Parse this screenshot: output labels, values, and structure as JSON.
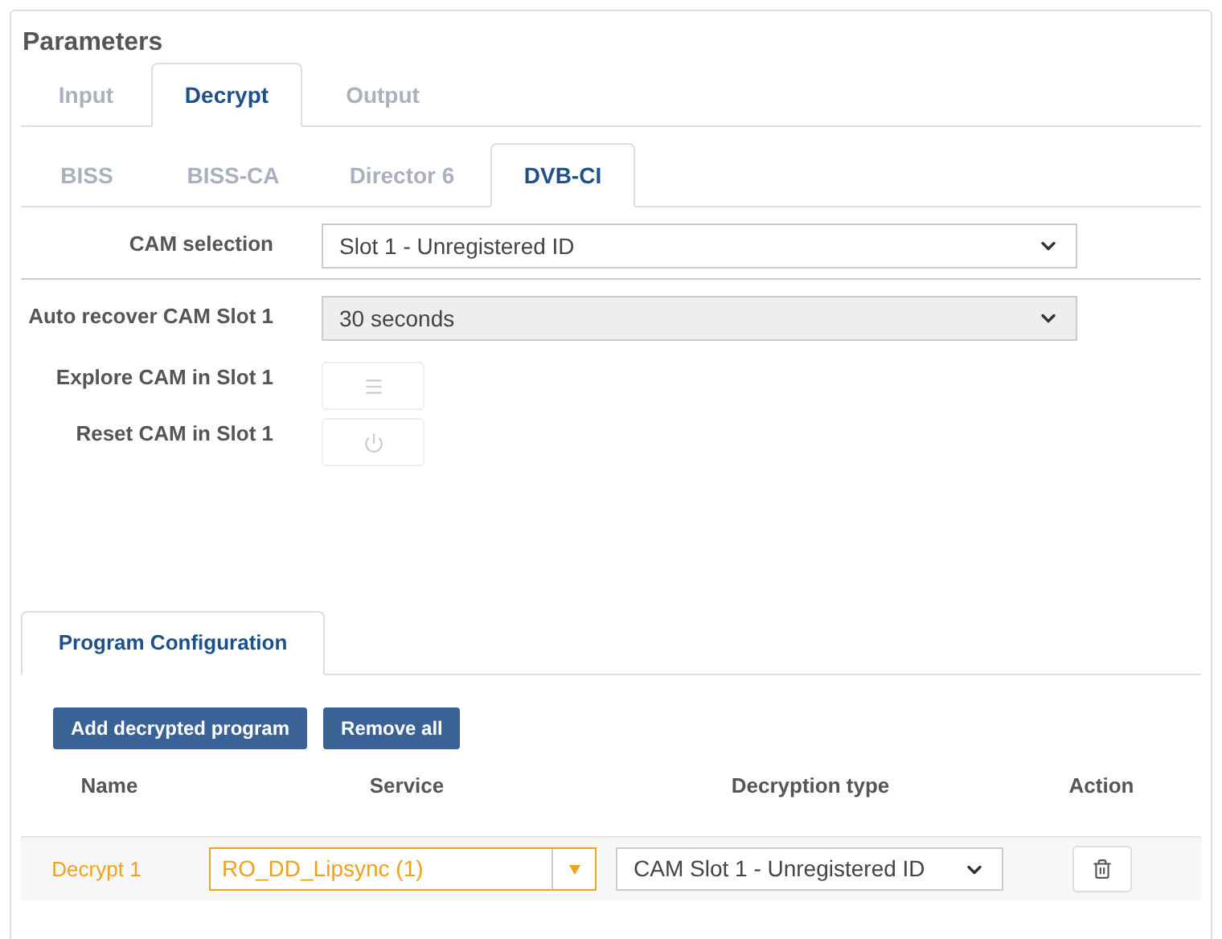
{
  "title": "Parameters",
  "tabs": [
    {
      "label": "Input",
      "selected": false
    },
    {
      "label": "Decrypt",
      "selected": true
    },
    {
      "label": "Output",
      "selected": false
    }
  ],
  "subtabs": [
    {
      "label": "BISS",
      "selected": false
    },
    {
      "label": "BISS-CA",
      "selected": false
    },
    {
      "label": "Director 6",
      "selected": false
    },
    {
      "label": "DVB-CI",
      "selected": true
    }
  ],
  "cam_selection": {
    "label": "CAM selection",
    "value": "Slot 1 - Unregistered ID",
    "disabled": false
  },
  "auto_recover": {
    "label": "Auto recover CAM Slot 1",
    "value": "30 seconds",
    "disabled": true
  },
  "actions": [
    {
      "label": "Explore CAM in Slot 1",
      "kind": "menu",
      "disabled": true
    },
    {
      "label": "Reset CAM in Slot 1",
      "kind": "power",
      "disabled": true
    }
  ],
  "program_tabs": [
    {
      "label": "Program Configuration",
      "selected": true
    }
  ],
  "buttons": [
    "Add decrypted program",
    "Remove all"
  ],
  "table": {
    "columns": [
      "Name",
      "Service",
      "Decryption type",
      "Action"
    ],
    "rows": [
      {
        "name": "Decrypt 1",
        "service": "RO_DD_Lipsync (1)",
        "decryption_type": "CAM Slot 1 - Unregistered ID"
      }
    ]
  }
}
